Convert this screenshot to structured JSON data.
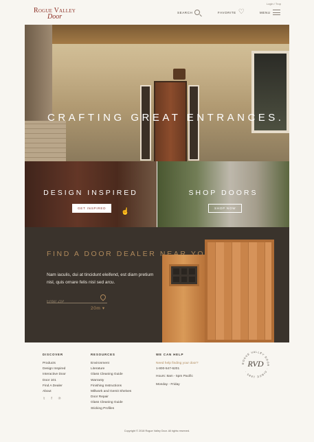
{
  "header": {
    "login": "Login / Trop",
    "logo_line1": "Rogue Valley",
    "logo_line2": "Door",
    "search_label": "SEARCH",
    "favorite_label": "FAVORITE",
    "menu_label": "MENU"
  },
  "hero": {
    "headline": "CRAFTING GREAT ENTRANCES."
  },
  "panels": {
    "left": {
      "title": "DESIGN INSPIRED",
      "button": "GET INSPIRED"
    },
    "right": {
      "title": "SHOP DOORS",
      "button": "SHOP NOW"
    }
  },
  "dealer": {
    "title": "FIND A DOOR DEALER NEAR YOU",
    "body": "Nam iaculis, dui at tincidunt eleifend, est diam pretium nisl, quis ornare felis nisl sed arcu.",
    "zip_placeholder": "Enter ZIP",
    "radius": "20m ▾"
  },
  "footer": {
    "discover": {
      "heading": "DISCOVER",
      "items": [
        "Products",
        "Design Inspired",
        "Interactive Door",
        "Door 101",
        "Find A Dealer",
        "About"
      ]
    },
    "resources": {
      "heading": "RESOURCES",
      "items": [
        "Environment",
        "Literature",
        "Glass Cleaning Guide",
        "Warranty",
        "Finishing Instructions",
        "Millwork and Gemit Shelves",
        "Door Repair",
        "Glass Cleaning Guide",
        "Sticking Profiles"
      ]
    },
    "help": {
      "heading": "WE CAN HELP",
      "question": "Need help finding your door?",
      "phone": "1-800-547-6201",
      "hours": "Hours: 8am - 5pm Pacific",
      "days": "Monday - Friday"
    },
    "seal": {
      "monogram": "RVD",
      "ring_text": "ROGUE VALLEY DOOR · SINCE 1985 ·"
    },
    "copyright": "Copyright © 2018 Rogue Valley Door. All rights reserved."
  },
  "colors": {
    "accent": "#b08a5c",
    "brand": "#8b2e23",
    "dark": "#3a332c",
    "background": "#f8f6f1"
  }
}
